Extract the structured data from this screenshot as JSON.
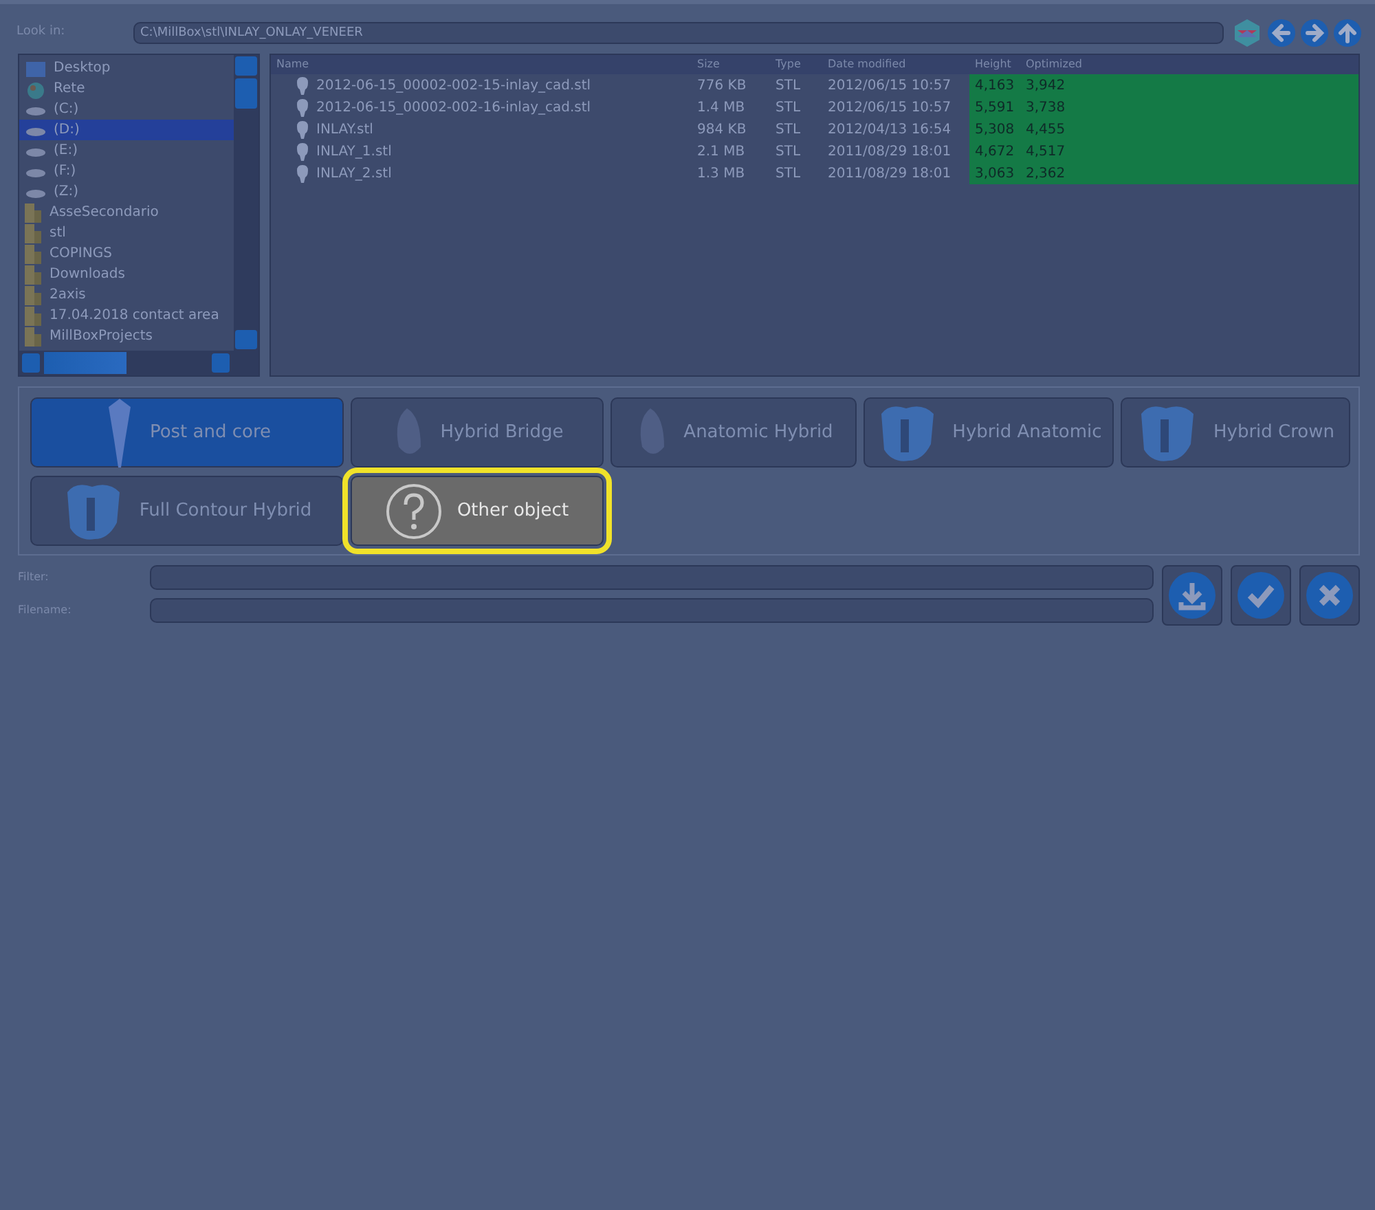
{
  "look_in": {
    "label": "Look in:",
    "path": "C:\\MillBox\\stl\\INLAY_ONLAY_VENEER"
  },
  "folder_tree": [
    {
      "kind": "desktop",
      "label": "Desktop",
      "selected": false
    },
    {
      "kind": "network",
      "label": "Rete",
      "selected": false
    },
    {
      "kind": "drive",
      "label": "(C:)",
      "selected": false
    },
    {
      "kind": "drive",
      "label": "(D:)",
      "selected": true
    },
    {
      "kind": "drive",
      "label": "(E:)",
      "selected": false
    },
    {
      "kind": "drive",
      "label": "(F:)",
      "selected": false
    },
    {
      "kind": "drive",
      "label": "(Z:)",
      "selected": false
    },
    {
      "kind": "folder",
      "label": "AsseSecondario",
      "selected": false
    },
    {
      "kind": "folder",
      "label": "stl",
      "selected": false
    },
    {
      "kind": "folder",
      "label": "COPINGS",
      "selected": false
    },
    {
      "kind": "folder",
      "label": "Downloads",
      "selected": false
    },
    {
      "kind": "folder",
      "label": "2axis",
      "selected": false
    },
    {
      "kind": "folder",
      "label": "17.04.2018 contact area",
      "selected": false
    },
    {
      "kind": "folder",
      "label": "MillBoxProjects",
      "selected": false
    }
  ],
  "files": {
    "columns": [
      "Name",
      "Size",
      "Type",
      "Date modified",
      "Height",
      "Optimized"
    ],
    "rows": [
      [
        "2012-06-15_00002-002-15-inlay_cad.stl",
        "776 KB",
        "STL",
        "2012/06/15 10:57",
        "4,163",
        "3,942"
      ],
      [
        "2012-06-15_00002-002-16-inlay_cad.stl",
        "1.4 MB",
        "STL",
        "2012/06/15 10:57",
        "5,591",
        "3,738"
      ],
      [
        "INLAY.stl",
        "984 KB",
        "STL",
        "2012/04/13 16:54",
        "5,308",
        "4,455"
      ],
      [
        "INLAY_1.stl",
        "2.1 MB",
        "STL",
        "2011/08/29 18:01",
        "4,672",
        "4,517"
      ],
      [
        "INLAY_2.stl",
        "1.3 MB",
        "STL",
        "2011/08/29 18:01",
        "3,063",
        "2,362"
      ]
    ]
  },
  "object_types": [
    {
      "kind": "post",
      "label": "Post and core",
      "selected": true,
      "highlighted": false
    },
    {
      "kind": "bridge",
      "label": "Hybrid Bridge",
      "selected": false,
      "highlighted": false
    },
    {
      "kind": "bridge",
      "label": "Anatomic Hybrid",
      "selected": false,
      "highlighted": false
    },
    {
      "kind": "crown",
      "label": "Hybrid Anatomic",
      "selected": false,
      "highlighted": false
    },
    {
      "kind": "crown",
      "label": "Hybrid Crown",
      "selected": false,
      "highlighted": false
    },
    {
      "kind": "crown",
      "label": "Full Contour Hybrid",
      "selected": false,
      "highlighted": false
    },
    {
      "kind": "question",
      "label": "Other object",
      "selected": false,
      "highlighted": true
    }
  ],
  "filter": {
    "label": "Filter:"
  },
  "filename": {
    "label": "Filename:"
  }
}
